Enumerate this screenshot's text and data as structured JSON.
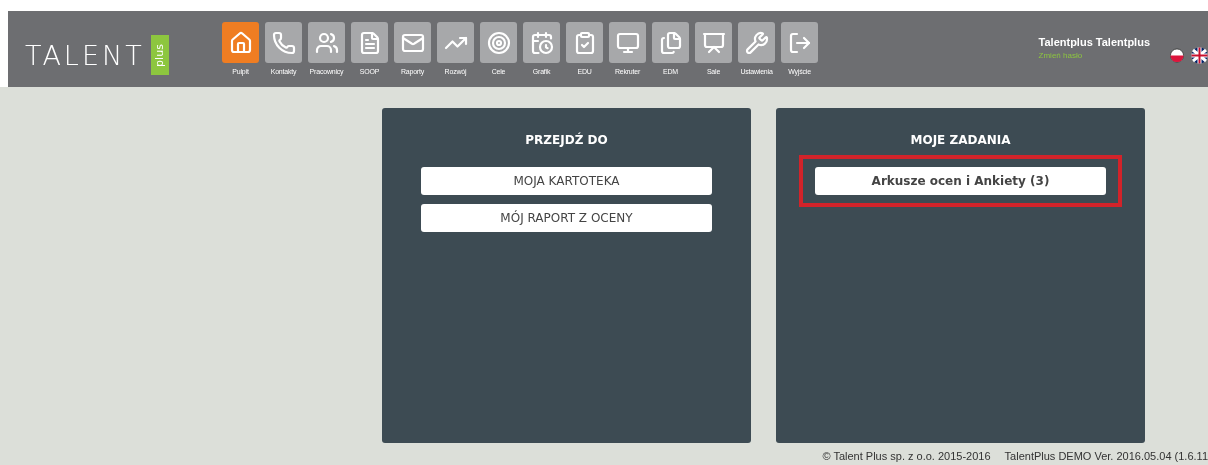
{
  "header": {
    "logo": {
      "text": "TALENT",
      "badge": "plus"
    },
    "nav": [
      {
        "label": "Pulpit",
        "kind": "home",
        "selected": true
      },
      {
        "label": "Kontakty",
        "kind": "phone",
        "selected": false
      },
      {
        "label": "Pracownicy",
        "kind": "users",
        "selected": false
      },
      {
        "label": "SOOP",
        "kind": "list",
        "selected": false
      },
      {
        "label": "Raporty",
        "kind": "mail",
        "selected": false
      },
      {
        "label": "Rozwój",
        "kind": "chart",
        "selected": false
      },
      {
        "label": "Cele",
        "kind": "target",
        "selected": false
      },
      {
        "label": "Grafik",
        "kind": "calendar",
        "selected": false
      },
      {
        "label": "EDU",
        "kind": "clipboard",
        "selected": false
      },
      {
        "label": "Rekruter",
        "kind": "monitor",
        "selected": false
      },
      {
        "label": "EDM",
        "kind": "document",
        "selected": false
      },
      {
        "label": "Sale",
        "kind": "presentation",
        "selected": false
      },
      {
        "label": "Ustawienia",
        "kind": "wrench",
        "selected": false
      },
      {
        "label": "Wyjście",
        "kind": "exit",
        "selected": false
      }
    ],
    "user": {
      "name": "Talentplus Talentplus",
      "link": "Zmień hasło"
    },
    "languages": [
      {
        "kind": "pl"
      },
      {
        "kind": "en"
      }
    ]
  },
  "panels": [
    {
      "title": "PRZEJDŹ DO",
      "buttons": [
        {
          "label": "MOJA KARTOTEKA",
          "highlighted": false,
          "bold": false
        },
        {
          "label": "MÓJ RAPORT Z OCENY",
          "highlighted": false,
          "bold": false
        }
      ]
    },
    {
      "title": "MOJE ZADANIA",
      "buttons": [
        {
          "label": "Arkusze ocen i Ankiety (3)",
          "highlighted": true,
          "bold": true
        }
      ]
    }
  ],
  "footer": {
    "copyright": "© Talent Plus sp. z o.o. 2015-2016",
    "version": "TalentPlus DEMO Ver. 2016.05.04 (1.6.11"
  }
}
